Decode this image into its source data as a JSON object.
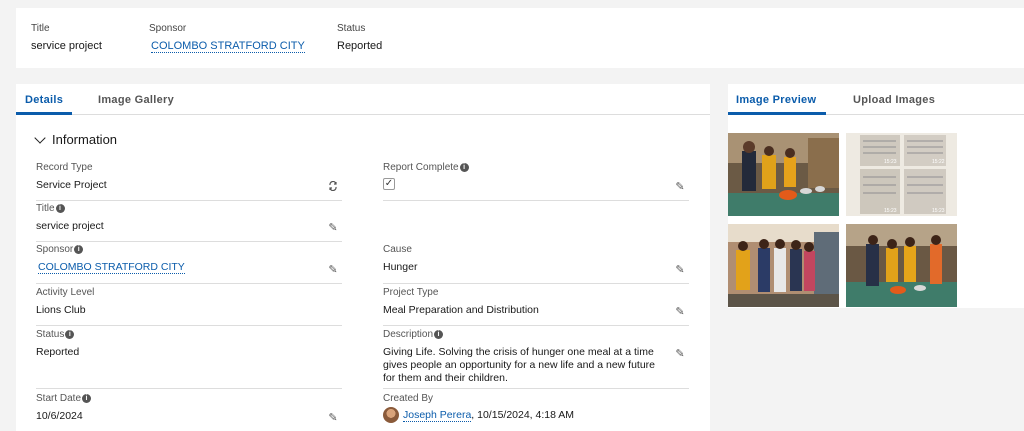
{
  "header": {
    "title_label": "Title",
    "title_value": "service project",
    "sponsor_label": "Sponsor",
    "sponsor_value": "COLOMBO STRATFORD CITY",
    "status_label": "Status",
    "status_value": "Reported"
  },
  "main_tabs": [
    "Details",
    "Image Gallery"
  ],
  "section_title": "Information",
  "fields": {
    "record_type": {
      "label": "Record Type",
      "value": "Service Project"
    },
    "report_complete": {
      "label": "Report Complete",
      "checked": true
    },
    "title": {
      "label": "Title",
      "value": "service project"
    },
    "sponsor": {
      "label": "Sponsor",
      "value": "COLOMBO STRATFORD CITY"
    },
    "cause": {
      "label": "Cause",
      "value": "Hunger"
    },
    "activity_level": {
      "label": "Activity Level",
      "value": "Lions Club"
    },
    "project_type": {
      "label": "Project Type",
      "value": "Meal Preparation and Distribution"
    },
    "status": {
      "label": "Status",
      "value": "Reported"
    },
    "description": {
      "label": "Description",
      "value": "Giving Life. Solving the crisis of hunger one meal at a time gives people an opportunity for a new life and a new future for them and their children."
    },
    "start_date": {
      "label": "Start Date",
      "value": "10/6/2024"
    },
    "created_by": {
      "label": "Created By",
      "name": "Joseph Perera",
      "date": ", 10/15/2024, 4:18 AM"
    }
  },
  "side_tabs": [
    "Image Preview",
    "Upload Images"
  ],
  "thumbnails": [
    {
      "icon": "photo-meal-prep"
    },
    {
      "icon": "photo-receipts",
      "stamps": [
        "15:23",
        "15:22",
        "15:23",
        "15:23"
      ]
    },
    {
      "icon": "photo-group"
    },
    {
      "icon": "photo-serving"
    }
  ],
  "colors": {
    "accent": "#0b5cab",
    "background": "#f3f3f3"
  }
}
